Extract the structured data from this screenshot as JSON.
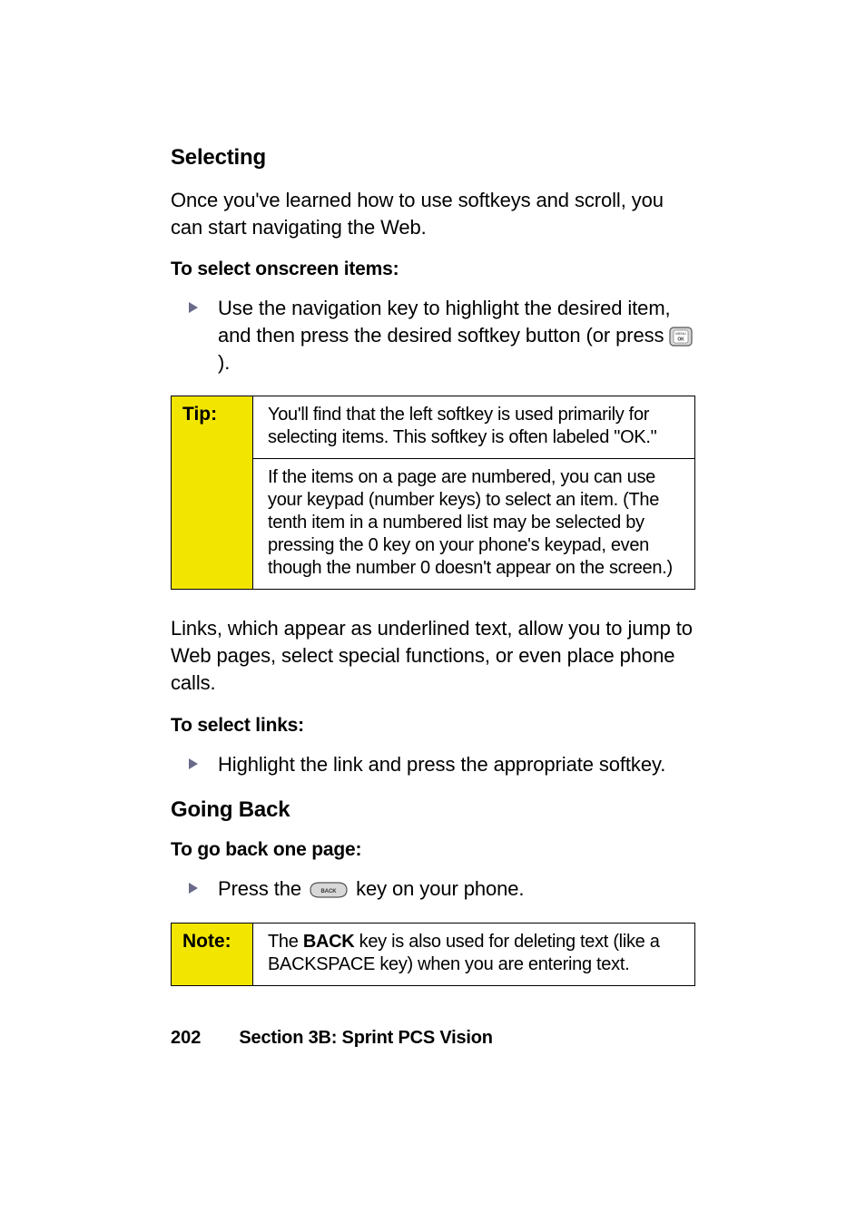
{
  "section1": {
    "heading": "Selecting",
    "intro": "Once you've learned how to use softkeys and scroll, you can start navigating the Web.",
    "instr1_label": "To select onscreen items:",
    "bullet1_a": "Use the navigation key to highlight the desired item, and then press the desired softkey button (or press ",
    "bullet1_b": ")."
  },
  "tip": {
    "label": "Tip:",
    "row1": "You'll find that the left softkey is used primarily for selecting items. This softkey is often labeled \"OK.\"",
    "row2": "If the items on a page are numbered, you can use your keypad (number keys) to select an item. (The tenth item in a numbered list may be selected by pressing the 0 key on your phone's keypad, even though the number 0 doesn't appear on the screen.)"
  },
  "links": {
    "para": "Links, which appear as underlined text, allow you to jump to Web pages, select special functions, or even place phone calls.",
    "instr_label": "To select links:",
    "bullet": "Highlight the link and press the appropriate softkey."
  },
  "section2": {
    "heading": "Going Back",
    "instr_label": "To go back one page:",
    "bullet_a": "Press the ",
    "bullet_b": " key on your phone."
  },
  "note": {
    "label": "Note:",
    "text_a": "The ",
    "text_bold": "BACK",
    "text_b": " key is also used for deleting text (like a BACKSPACE key) when you are entering text."
  },
  "footer": {
    "page": "202",
    "section": "Section 3B: Sprint PCS Vision"
  }
}
